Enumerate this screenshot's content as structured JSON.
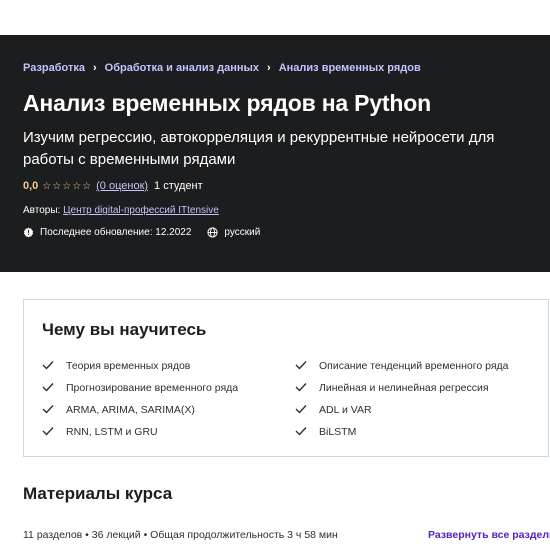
{
  "breadcrumb": {
    "items": [
      "Разработка",
      "Обработка и анализ данных",
      "Анализ временных рядов"
    ],
    "separator": "›"
  },
  "course": {
    "title": "Анализ временных рядов на Python",
    "subtitle": "Изучим регрессию, автокорреляция и рекуррентные нейросети для работы с временными рядами",
    "rating": "0,0",
    "stars": "☆☆☆☆☆",
    "rating_count": "(0 оценок)",
    "students": "1 студент",
    "authors_label": "Авторы:",
    "authors_link": "Центр digital-профессий ITtensive",
    "last_update": "Последнее обновление: 12.2022",
    "language": "русский"
  },
  "learn": {
    "title": "Чему вы научитесь",
    "left": [
      "Теория временных рядов",
      "Прогнозирование временного ряда",
      "ARMA, ARIMA, SARIMA(X)",
      "RNN, LSTM и GRU"
    ],
    "right": [
      "Описание тенденций временного ряда",
      "Линейная и нелинейная регрессия",
      "ADL и VAR",
      "BiLSTM"
    ]
  },
  "materials": {
    "title": "Материалы курса",
    "stats": "11 разделов • 36 лекций • Общая продолжительность 3 ч 58 мин",
    "expand_all": "Развернуть все разделы"
  },
  "colors": {
    "hero_bg": "#1c1d1f",
    "link_purple": "#c0c4fc",
    "star_gold": "#f3ca8c",
    "accent_purple": "#5022c3"
  },
  "icons": {
    "update": "alert-badge-icon",
    "language": "globe-icon",
    "check": "check-icon"
  }
}
